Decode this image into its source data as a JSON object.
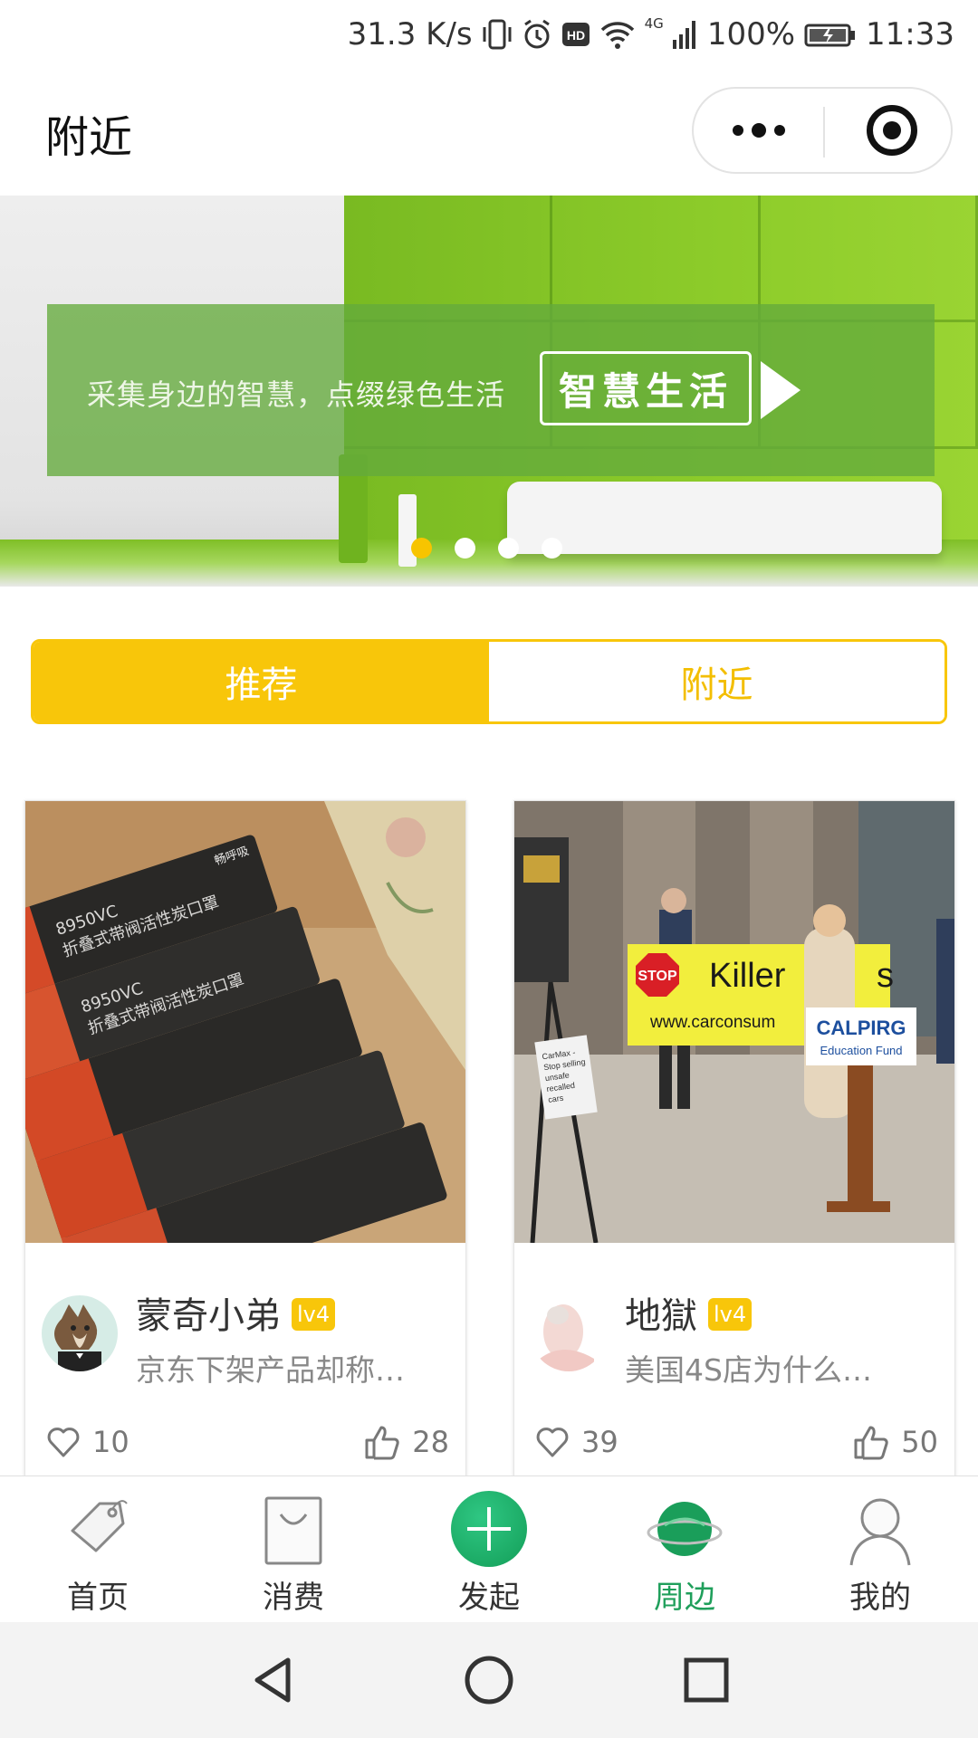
{
  "status_bar": {
    "net_speed": "31.3 K/s",
    "network_type": "4G",
    "battery": "100%",
    "time": "11:33"
  },
  "header": {
    "title": "附近",
    "more_icon": "more-dots-icon",
    "close_icon": "target-icon"
  },
  "banner": {
    "slogan": "采集身边的智慧，点缀绿色生活",
    "button_text": "智慧生活",
    "dots_total": 4,
    "active_dot": 0,
    "accent_color": "#f7c400"
  },
  "segment": {
    "tabs": [
      {
        "label": "推荐",
        "active": true
      },
      {
        "label": "附近",
        "active": false
      }
    ],
    "color": "#f8c60a"
  },
  "cards": [
    {
      "author": "蒙奇小弟",
      "level": "lv4",
      "title": "京东下架产品却称…",
      "favorites": "10",
      "likes": "28",
      "photo_text": [
        "8950VC",
        "折叠式带阀活性炭口罩",
        "畅呼吸"
      ]
    },
    {
      "author": "地獄",
      "level": "lv4",
      "title": "美国4S店为什么…",
      "favorites": "39",
      "likes": "50",
      "photo_text": [
        "STOP",
        "Killer",
        "s",
        "www.carconsum",
        "CALPIRG",
        "Education Fund",
        "CarMax -",
        "Stop selling",
        "unsafe",
        "recalled",
        "cars"
      ]
    }
  ],
  "tabbar": {
    "items": [
      {
        "label": "首页",
        "icon": "tag-icon",
        "active": false
      },
      {
        "label": "消费",
        "icon": "shopping-bag-icon",
        "active": false
      },
      {
        "label": "发起",
        "icon": "plus-circle-icon",
        "active": false
      },
      {
        "label": "周边",
        "icon": "planet-icon",
        "active": true
      },
      {
        "label": "我的",
        "icon": "user-icon",
        "active": false
      }
    ],
    "active_color": "#1f9f5b"
  },
  "navbar": {
    "icons": [
      "back-triangle-icon",
      "home-circle-icon",
      "recents-square-icon"
    ]
  }
}
